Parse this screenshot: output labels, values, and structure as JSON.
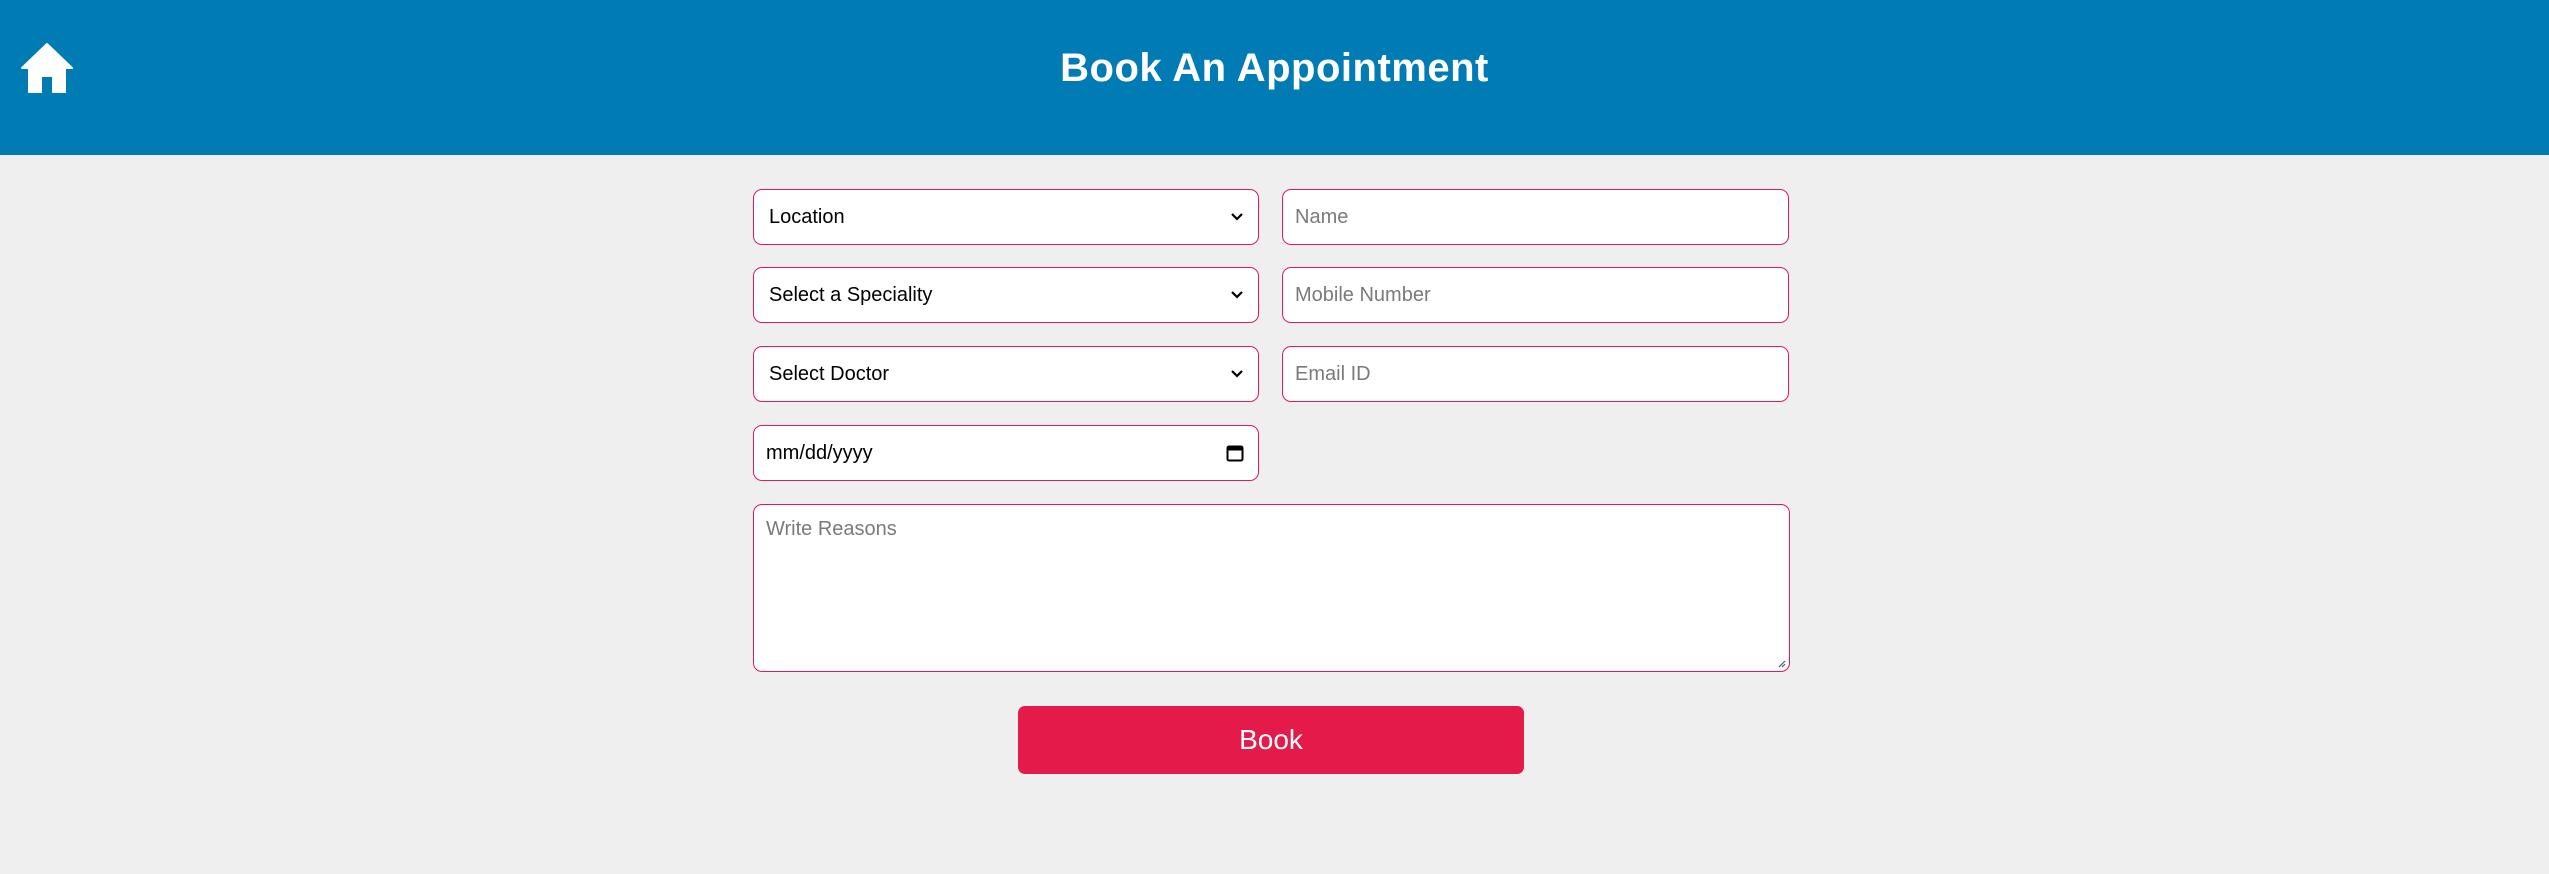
{
  "header": {
    "title": "Book An Appointment",
    "home_icon": "home-icon",
    "background": "#007bb4"
  },
  "form": {
    "location": {
      "value": "Location"
    },
    "speciality": {
      "value": "Select a Speciality"
    },
    "doctor": {
      "value": "Select Doctor"
    },
    "date": {
      "value": "mm/dd/yyyy"
    },
    "name": {
      "placeholder": "Name"
    },
    "mobile": {
      "placeholder": "Mobile Number"
    },
    "email": {
      "placeholder": "Email ID"
    },
    "reasons": {
      "placeholder": "Write Reasons"
    },
    "book_label": "Book",
    "border_color": "#e2195c",
    "button_color": "#e31a4a"
  }
}
